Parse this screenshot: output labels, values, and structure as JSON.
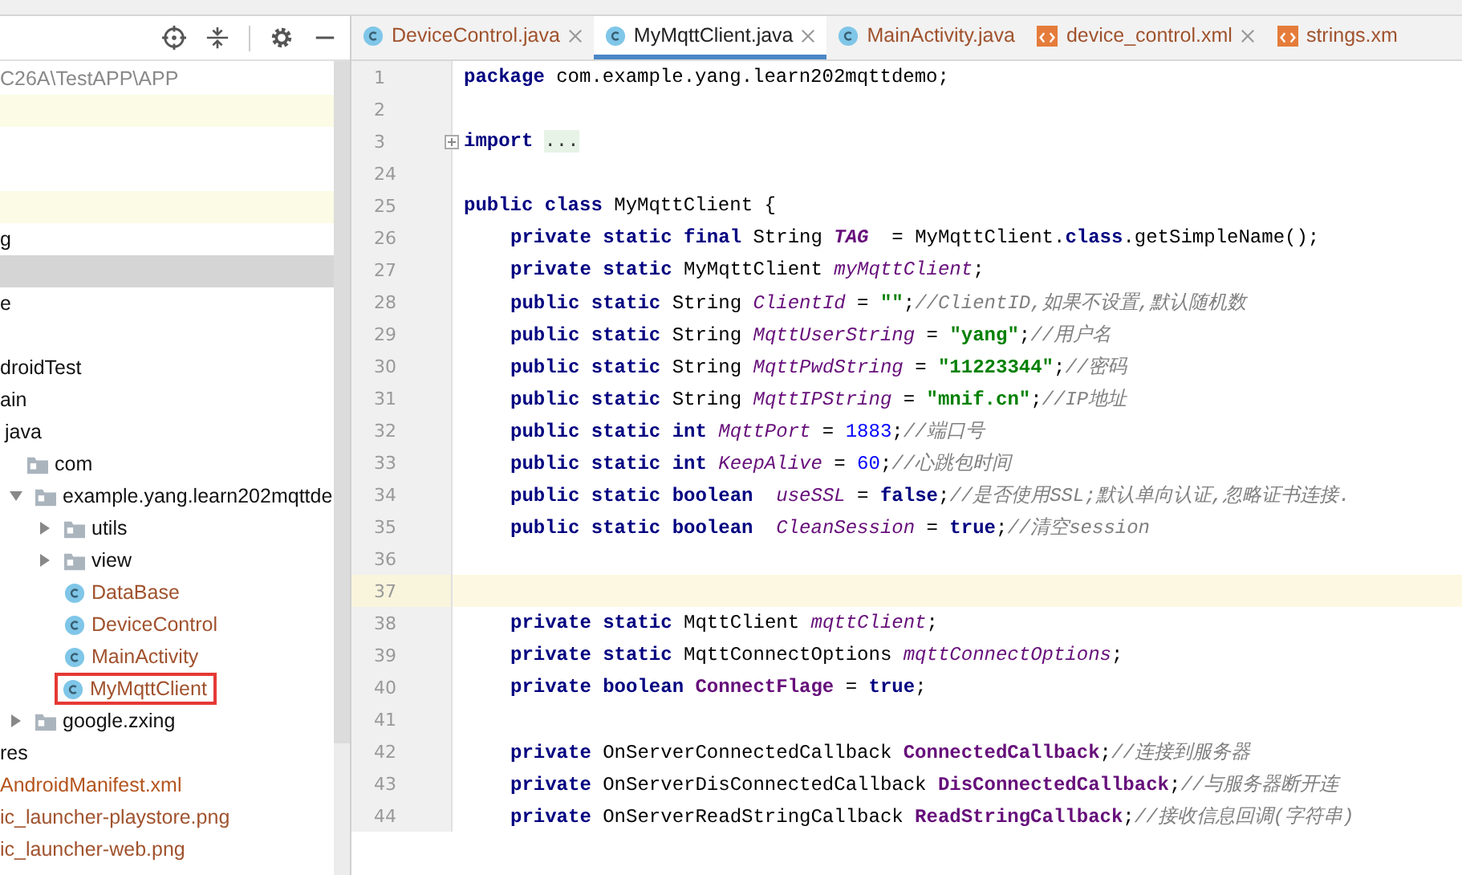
{
  "tabs": [
    {
      "label": "DeviceControl.java",
      "kind": "class",
      "selected": false,
      "closable": true,
      "color": "#a0522d"
    },
    {
      "label": "MyMqttClient.java",
      "kind": "class",
      "selected": true,
      "closable": true,
      "color": "#222222"
    },
    {
      "label": "MainActivity.java",
      "kind": "class",
      "selected": false,
      "closable": false,
      "color": "#a0522d"
    },
    {
      "label": "device_control.xml",
      "kind": "xml",
      "selected": false,
      "closable": true,
      "color": "#a0522d"
    },
    {
      "label": "strings.xm",
      "kind": "xml",
      "selected": false,
      "closable": false,
      "color": "#a0522d"
    }
  ],
  "project_tree": {
    "items": [
      {
        "kind": "path",
        "label": "C26A\\TestAPP\\APP",
        "selected": false,
        "highlighted": false
      },
      {
        "kind": "blank",
        "selected": false,
        "highlighted": true
      },
      {
        "kind": "blank",
        "selected": false,
        "highlighted": false
      },
      {
        "kind": "blank",
        "selected": false,
        "highlighted": false
      },
      {
        "kind": "blank",
        "selected": false,
        "highlighted": true
      },
      {
        "kind": "text",
        "label": "g",
        "selected": false,
        "highlighted": false
      },
      {
        "kind": "blank",
        "selected": true,
        "highlighted": false
      },
      {
        "kind": "text",
        "label": "e",
        "selected": false,
        "highlighted": false
      },
      {
        "kind": "blank",
        "selected": false,
        "highlighted": false
      },
      {
        "kind": "text",
        "label": "droidTest",
        "selected": false,
        "highlighted": false
      },
      {
        "kind": "text",
        "label": "ain",
        "selected": false,
        "highlighted": false
      },
      {
        "kind": "text",
        "label": "java",
        "selected": false,
        "highlighted": false,
        "children": [
          {
            "kind": "folder",
            "label": "com",
            "selected": false,
            "highlighted": false,
            "children": [
              {
                "kind": "folder",
                "label": "example.yang.learn202mqttde",
                "expanded": true,
                "selected": false,
                "highlighted": false,
                "children": [
                  {
                    "kind": "folder",
                    "label": "utils",
                    "expanded": false,
                    "selected": false,
                    "highlighted": false
                  },
                  {
                    "kind": "folder",
                    "label": "view",
                    "expanded": false,
                    "selected": false,
                    "highlighted": false
                  },
                  {
                    "kind": "class",
                    "label": "DataBase",
                    "color": "#a0522d",
                    "selected": false,
                    "highlighted": false
                  },
                  {
                    "kind": "class",
                    "label": "DeviceControl",
                    "color": "#a0522d",
                    "selected": false,
                    "highlighted": false
                  },
                  {
                    "kind": "class",
                    "label": "MainActivity",
                    "color": "#a0522d",
                    "selected": false,
                    "highlighted": false
                  },
                  {
                    "kind": "class",
                    "label": "MyMqttClient",
                    "color": "#a0522d",
                    "selected": false,
                    "highlighted": false,
                    "boxed": true
                  }
                ]
              },
              {
                "kind": "folder",
                "label": "google.zxing",
                "expanded": false,
                "selected": false,
                "highlighted": false
              }
            ]
          }
        ]
      },
      {
        "kind": "text",
        "label": "res",
        "selected": false,
        "highlighted": false
      },
      {
        "kind": "text",
        "label": "AndroidManifest.xml",
        "color": "#b5541c",
        "selected": false,
        "highlighted": false
      },
      {
        "kind": "text",
        "label": "ic_launcher-playstore.png",
        "color": "#a0522d",
        "selected": false,
        "highlighted": false
      },
      {
        "kind": "text",
        "label": "ic_launcher-web.png",
        "color": "#a0522d",
        "selected": false,
        "highlighted": false
      }
    ]
  },
  "editor": {
    "lines": [
      {
        "n": "1",
        "current": false,
        "folded": false,
        "indent": false,
        "tokens": [
          {
            "kind": "kw",
            "text": "package "
          },
          {
            "kind": "p",
            "text": "com.example.yang.learn202mqttdemo;"
          }
        ]
      },
      {
        "n": "2",
        "current": false,
        "folded": false
      },
      {
        "n": "3",
        "current": false,
        "folded": true,
        "indent": false,
        "tokens": [
          {
            "kind": "kw",
            "text": "import"
          },
          {
            "kind": "fold",
            "text": "..."
          }
        ]
      },
      {
        "n": "24",
        "current": false,
        "folded": false
      },
      {
        "n": "25",
        "current": false,
        "folded": false,
        "indent": false,
        "tokens": [
          {
            "kind": "kw",
            "text": "public class "
          },
          {
            "kind": "p",
            "text": "MyMqttClient {"
          }
        ]
      },
      {
        "n": "26",
        "current": false,
        "folded": false,
        "indent": true,
        "tokens": [
          {
            "kind": "kw",
            "text": "private static final "
          },
          {
            "kind": "p",
            "text": "String "
          },
          {
            "kind": "const",
            "text": "TAG"
          },
          {
            "kind": "p",
            "text": "  = MyMqttClient."
          },
          {
            "kind": "kw",
            "text": "class"
          },
          {
            "kind": "p",
            "text": ".getSimpleName();"
          }
        ]
      },
      {
        "n": "27",
        "current": false,
        "folded": false,
        "indent": true,
        "tokens": [
          {
            "kind": "kw",
            "text": "private static "
          },
          {
            "kind": "p",
            "text": "MyMqttClient "
          },
          {
            "kind": "sfield",
            "text": "myMqttClient"
          },
          {
            "kind": "p",
            "text": ";"
          }
        ]
      },
      {
        "n": "28",
        "current": false,
        "folded": false,
        "indent": true,
        "tokens": [
          {
            "kind": "kw",
            "text": "public static "
          },
          {
            "kind": "p",
            "text": "String "
          },
          {
            "kind": "sfield",
            "text": "ClientId"
          },
          {
            "kind": "p",
            "text": " = "
          },
          {
            "kind": "str",
            "text": "\"\""
          },
          {
            "kind": "p",
            "text": ";"
          },
          {
            "kind": "cmt",
            "text": "//ClientID,如果不设置,默认随机数"
          }
        ]
      },
      {
        "n": "29",
        "current": false,
        "folded": false,
        "indent": true,
        "tokens": [
          {
            "kind": "kw",
            "text": "public static "
          },
          {
            "kind": "p",
            "text": "String "
          },
          {
            "kind": "sfield",
            "text": "MqttUserString"
          },
          {
            "kind": "p",
            "text": " = "
          },
          {
            "kind": "str",
            "text": "\"yang\""
          },
          {
            "kind": "p",
            "text": ";"
          },
          {
            "kind": "cmt",
            "text": "//用户名"
          }
        ]
      },
      {
        "n": "30",
        "current": false,
        "folded": false,
        "indent": true,
        "tokens": [
          {
            "kind": "kw",
            "text": "public static "
          },
          {
            "kind": "p",
            "text": "String "
          },
          {
            "kind": "sfield",
            "text": "MqttPwdString"
          },
          {
            "kind": "p",
            "text": " = "
          },
          {
            "kind": "str",
            "text": "\"11223344\""
          },
          {
            "kind": "p",
            "text": ";"
          },
          {
            "kind": "cmt",
            "text": "//密码"
          }
        ]
      },
      {
        "n": "31",
        "current": false,
        "folded": false,
        "indent": true,
        "tokens": [
          {
            "kind": "kw",
            "text": "public static "
          },
          {
            "kind": "p",
            "text": "String "
          },
          {
            "kind": "sfield",
            "text": "MqttIPString"
          },
          {
            "kind": "p",
            "text": " = "
          },
          {
            "kind": "str",
            "text": "\"mnif.cn\""
          },
          {
            "kind": "p",
            "text": ";"
          },
          {
            "kind": "cmt",
            "text": "//IP地址"
          }
        ]
      },
      {
        "n": "32",
        "current": false,
        "folded": false,
        "indent": true,
        "tokens": [
          {
            "kind": "kw",
            "text": "public static int "
          },
          {
            "kind": "sfield",
            "text": "MqttPort"
          },
          {
            "kind": "p",
            "text": " = "
          },
          {
            "kind": "num",
            "text": "1883"
          },
          {
            "kind": "p",
            "text": ";"
          },
          {
            "kind": "cmt",
            "text": "//端口号"
          }
        ]
      },
      {
        "n": "33",
        "current": false,
        "folded": false,
        "indent": true,
        "tokens": [
          {
            "kind": "kw",
            "text": "public static int "
          },
          {
            "kind": "sfield",
            "text": "KeepAlive"
          },
          {
            "kind": "p",
            "text": " = "
          },
          {
            "kind": "num",
            "text": "60"
          },
          {
            "kind": "p",
            "text": ";"
          },
          {
            "kind": "cmt",
            "text": "//心跳包时间"
          }
        ]
      },
      {
        "n": "34",
        "current": false,
        "folded": false,
        "indent": true,
        "tokens": [
          {
            "kind": "kw",
            "text": "public static boolean  "
          },
          {
            "kind": "sfield",
            "text": "useSSL"
          },
          {
            "kind": "p",
            "text": " = "
          },
          {
            "kind": "kw",
            "text": "false"
          },
          {
            "kind": "p",
            "text": ";"
          },
          {
            "kind": "cmt",
            "text": "//是否使用SSL;默认单向认证,忽略证书连接."
          }
        ]
      },
      {
        "n": "35",
        "current": false,
        "folded": false,
        "indent": true,
        "tokens": [
          {
            "kind": "kw",
            "text": "public static boolean  "
          },
          {
            "kind": "sfield",
            "text": "CleanSession"
          },
          {
            "kind": "p",
            "text": " = "
          },
          {
            "kind": "kw",
            "text": "true"
          },
          {
            "kind": "p",
            "text": ";"
          },
          {
            "kind": "cmt",
            "text": "//清空session"
          }
        ]
      },
      {
        "n": "36",
        "current": false,
        "folded": false
      },
      {
        "n": "37",
        "current": true,
        "folded": false
      },
      {
        "n": "38",
        "current": false,
        "folded": false,
        "indent": true,
        "tokens": [
          {
            "kind": "kw",
            "text": "private static "
          },
          {
            "kind": "p",
            "text": "MqttClient "
          },
          {
            "kind": "sfield",
            "text": "mqttClient"
          },
          {
            "kind": "p",
            "text": ";"
          }
        ]
      },
      {
        "n": "39",
        "current": false,
        "folded": false,
        "indent": true,
        "tokens": [
          {
            "kind": "kw",
            "text": "private static "
          },
          {
            "kind": "p",
            "text": "MqttConnectOptions "
          },
          {
            "kind": "sfield",
            "text": "mqttConnectOptions"
          },
          {
            "kind": "p",
            "text": ";"
          }
        ]
      },
      {
        "n": "40",
        "current": false,
        "folded": false,
        "indent": true,
        "tokens": [
          {
            "kind": "kw",
            "text": "private boolean "
          },
          {
            "kind": "ifield",
            "text": "ConnectFlage"
          },
          {
            "kind": "p",
            "text": " = "
          },
          {
            "kind": "kw",
            "text": "true"
          },
          {
            "kind": "p",
            "text": ";"
          }
        ]
      },
      {
        "n": "41",
        "current": false,
        "folded": false
      },
      {
        "n": "42",
        "current": false,
        "folded": false,
        "indent": true,
        "tokens": [
          {
            "kind": "kw",
            "text": "private "
          },
          {
            "kind": "p",
            "text": "OnServerConnectedCallback "
          },
          {
            "kind": "ifield",
            "text": "ConnectedCallback"
          },
          {
            "kind": "p",
            "text": ";"
          },
          {
            "kind": "cmt",
            "text": "//连接到服务器"
          }
        ]
      },
      {
        "n": "43",
        "current": false,
        "folded": false,
        "indent": true,
        "tokens": [
          {
            "kind": "kw",
            "text": "private "
          },
          {
            "kind": "p",
            "text": "OnServerDisConnectedCallback "
          },
          {
            "kind": "ifield",
            "text": "DisConnectedCallback"
          },
          {
            "kind": "p",
            "text": ";"
          },
          {
            "kind": "cmt",
            "text": "//与服务器断开连"
          }
        ]
      },
      {
        "n": "44",
        "current": false,
        "folded": false,
        "indent": true,
        "tokens": [
          {
            "kind": "kw",
            "text": "private "
          },
          {
            "kind": "p",
            "text": "OnServerReadStringCallback "
          },
          {
            "kind": "ifield",
            "text": "ReadStringCallback"
          },
          {
            "kind": "p",
            "text": ";"
          },
          {
            "kind": "cmt",
            "text": "//接收信息回调(字符串)"
          }
        ]
      }
    ]
  }
}
